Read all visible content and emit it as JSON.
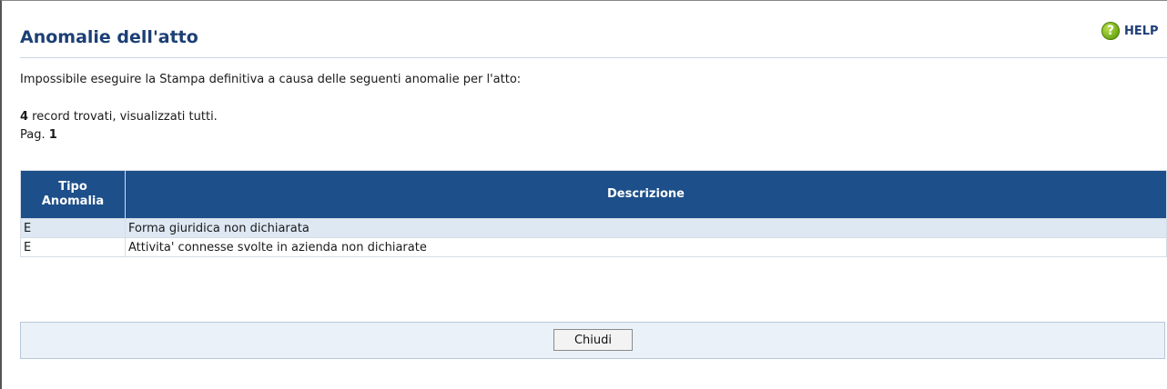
{
  "help": {
    "label": "HELP",
    "icon": "help-icon"
  },
  "header": {
    "title": "Anomalie dell'atto"
  },
  "message": "Impossibile eseguire la Stampa definitiva a causa delle seguenti anomalie per l'atto:",
  "results": {
    "count": "4",
    "count_text": " record trovati, visualizzati tutti.",
    "page_label": "Pag. ",
    "page_number": "1"
  },
  "table": {
    "headers": [
      "Tipo Anomalia",
      "Descrizione"
    ],
    "rows": [
      [
        "E",
        "Forma giuridica non dichiarata"
      ],
      [
        "E",
        "Attivita' connesse svolte in azienda non dichiarate"
      ]
    ]
  },
  "footer": {
    "close_label": "Chiudi"
  }
}
